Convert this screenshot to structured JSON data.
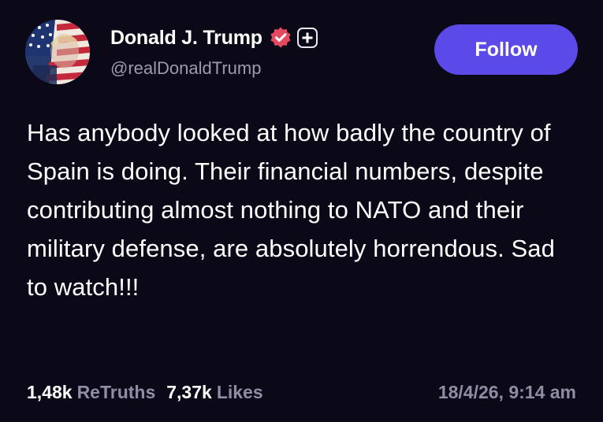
{
  "author": {
    "display_name": "Donald J. Trump",
    "handle": "@realDonaldTrump",
    "avatar_icon": "flag-portrait-avatar",
    "verified_icon": "verified-badge-icon",
    "plus_icon": "plus-badge-icon"
  },
  "actions": {
    "follow_label": "Follow"
  },
  "post": {
    "text": "Has anybody looked at how badly the country of Spain is doing. Their financial numbers, despite contributing almost nothing to NATO and their military defense, are absolutely horrendous. Sad to watch!!!"
  },
  "stats": {
    "retruths_count": "1,48k",
    "retruths_label": "ReTruths",
    "likes_count": "7,37k",
    "likes_label": "Likes"
  },
  "timestamp": "18/4/26, 9:14 am",
  "colors": {
    "background": "#0b0918",
    "accent": "#5b49e8",
    "verified": "#e34a5f",
    "muted_text": "#8f8da3"
  }
}
